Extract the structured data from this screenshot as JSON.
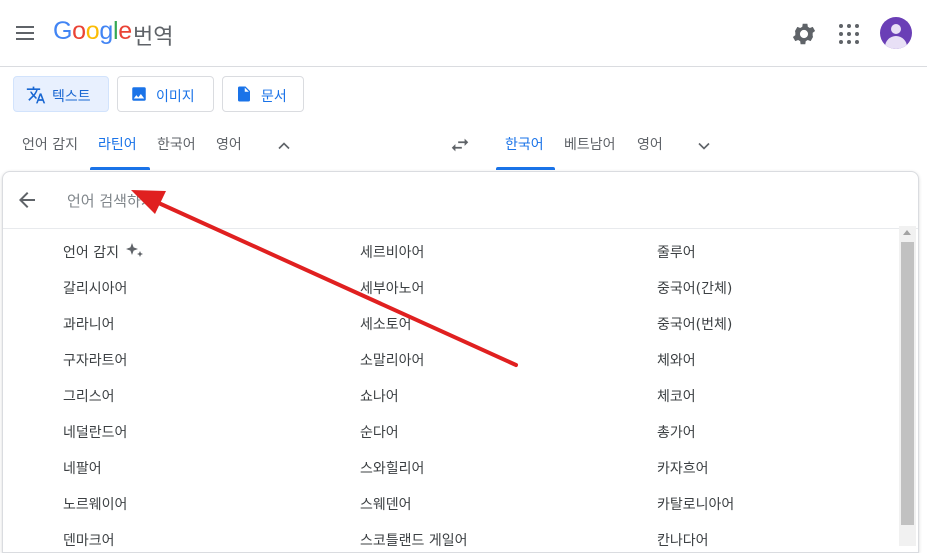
{
  "header": {
    "logo": {
      "G": "G",
      "o1": "o",
      "o2": "o",
      "g": "g",
      "l": "l",
      "e": "e"
    },
    "app_name": "번역",
    "icons": {
      "menu": "hamburger-icon",
      "settings": "gear-icon",
      "apps": "apps-grid-icon",
      "account": "account-avatar"
    }
  },
  "modes": [
    {
      "label": "텍스트",
      "icon": "translate-icon",
      "active": true
    },
    {
      "label": "이미지",
      "icon": "image-icon",
      "active": false
    },
    {
      "label": "문서",
      "icon": "document-icon",
      "active": false
    }
  ],
  "source_langs": [
    {
      "label": "언어 감지",
      "active": false
    },
    {
      "label": "라틴어",
      "active": true
    },
    {
      "label": "한국어",
      "active": false
    },
    {
      "label": "영어",
      "active": false
    }
  ],
  "target_langs": [
    {
      "label": "한국어",
      "active": true
    },
    {
      "label": "베트남어",
      "active": false
    },
    {
      "label": "영어",
      "active": false
    }
  ],
  "search": {
    "placeholder": "언어 검색하기"
  },
  "languages": {
    "col1": [
      "언어 감지",
      "갈리시아어",
      "과라니어",
      "구자라트어",
      "그리스어",
      "네덜란드어",
      "네팔어",
      "노르웨이어",
      "덴마크어"
    ],
    "col2": [
      "세르비아어",
      "세부아노어",
      "세소토어",
      "소말리아어",
      "쇼나어",
      "순다어",
      "스와힐리어",
      "스웨덴어",
      "스코틀랜드 게일어"
    ],
    "col3": [
      "줄루어",
      "중국어(간체)",
      "중국어(번체)",
      "체와어",
      "체코어",
      "총가어",
      "카자흐어",
      "카탈로니아어",
      "칸나다어"
    ]
  },
  "colors": {
    "accent": "#1a73e8",
    "annotation_arrow": "#e02020"
  }
}
